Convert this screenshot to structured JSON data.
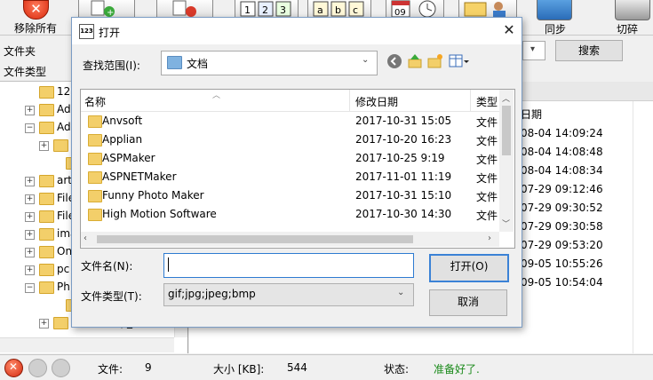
{
  "toolbar": {
    "remove_all_label": "移除所有",
    "sync_label": "同步",
    "switch_label": "切碎",
    "number_icon_text": "1 2 3",
    "alpha_icon_text": "a b c",
    "calendar_icon_text": "09"
  },
  "left_panel": {
    "folder_label": "文件夹",
    "filetype_label": "文件类型",
    "tree": [
      {
        "text": "12",
        "expander": ""
      },
      {
        "text": "Ad",
        "expander": "+"
      },
      {
        "text": "Ad",
        "expander": "-"
      },
      {
        "text": "",
        "expander": "+"
      },
      {
        "text": "",
        "expander": ""
      },
      {
        "text": "art",
        "expander": "+"
      },
      {
        "text": "File",
        "expander": "+"
      },
      {
        "text": "File",
        "expander": "+"
      },
      {
        "text": "ima",
        "expander": "+"
      },
      {
        "text": "On",
        "expander": "+"
      },
      {
        "text": "pc",
        "expander": "+"
      },
      {
        "text": "Ph",
        "expander": "-"
      },
      {
        "text": "",
        "expander": ""
      },
      {
        "text": "Photoshop_CS6",
        "expander": "+"
      }
    ]
  },
  "right_panel": {
    "search_label": "搜索",
    "date_header": "日期",
    "dates": [
      "08-04 14:09:24",
      "08-04 14:08:48",
      "08-04 14:08:34",
      "07-29 09:12:46",
      "07-29 09:30:52",
      "07-29 09:30:58",
      "07-29 09:53:20",
      "09-05 10:55:26",
      "09-05 10:54:04"
    ]
  },
  "dialog": {
    "title": "打开",
    "app_icon_text": "123",
    "lookin_label": "查找范围(I):",
    "lookin_value": "文档",
    "columns": {
      "name": "名称",
      "modified": "修改日期",
      "type": "类型"
    },
    "files": [
      {
        "name": "Anvsoft",
        "modified": "2017-10-31 15:05",
        "type": "文件"
      },
      {
        "name": "Applian",
        "modified": "2017-10-20 16:23",
        "type": "文件"
      },
      {
        "name": "ASPMaker",
        "modified": "2017-10-25 9:19",
        "type": "文件"
      },
      {
        "name": "ASPNETMaker",
        "modified": "2017-11-01 11:19",
        "type": "文件"
      },
      {
        "name": "Funny Photo Maker",
        "modified": "2017-10-31 15:10",
        "type": "文件"
      },
      {
        "name": "High Motion Software",
        "modified": "2017-10-30 14:30",
        "type": "文件"
      }
    ],
    "filename_label": "文件名(N):",
    "filename_value": "",
    "filetype_label": "文件类型(T):",
    "filetype_value": "gif;jpg;jpeg;bmp",
    "open_button": "打开(O)",
    "cancel_button": "取消"
  },
  "status": {
    "files_label": "文件:",
    "files_count": "9",
    "size_label": "大小 [KB]:",
    "size_value": "544",
    "state_label": "状态:",
    "state_value": "准备好了.",
    "state_color": "#1a8a1a"
  }
}
